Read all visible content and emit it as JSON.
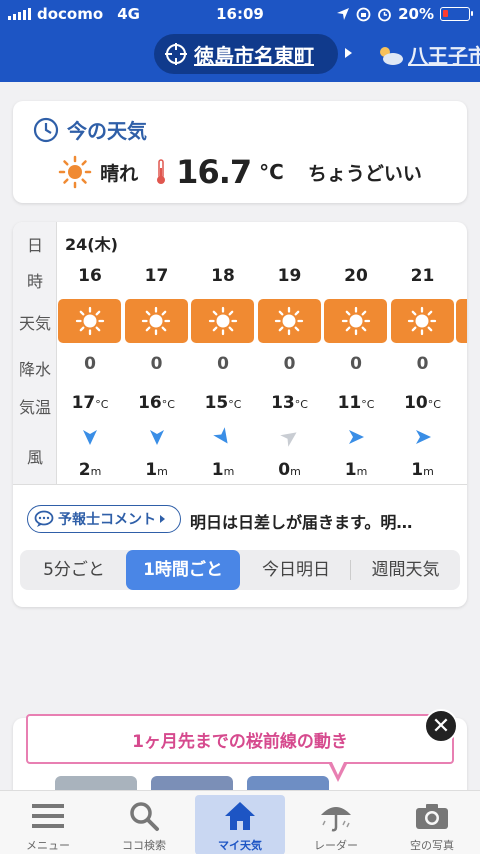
{
  "status": {
    "carrier": "docomo",
    "network": "4G",
    "time": "16:09",
    "battery": "20%"
  },
  "header": {
    "current_location": "徳島市名東町",
    "next_location": "八王子市"
  },
  "now": {
    "title": "今の天気",
    "condition": "晴れ",
    "temp": "16.7",
    "unit": "°C",
    "feel": "ちょうどいい"
  },
  "forecast": {
    "day": "24(木)",
    "row_labels": {
      "day": "日",
      "hour": "時",
      "weather": "天気",
      "rain": "降水",
      "temp": "気温",
      "wind": "風"
    },
    "temp_unit": "°C",
    "wind_unit": "m",
    "hours": [
      {
        "hour": "16",
        "rain": "0",
        "temp": "17",
        "wind": "2",
        "wind_dir": "down"
      },
      {
        "hour": "17",
        "rain": "0",
        "temp": "16",
        "wind": "1",
        "wind_dir": "down"
      },
      {
        "hour": "18",
        "rain": "0",
        "temp": "15",
        "wind": "1",
        "wind_dir": "down-right"
      },
      {
        "hour": "19",
        "rain": "0",
        "temp": "13",
        "wind": "0",
        "wind_dir": "up-right"
      },
      {
        "hour": "20",
        "rain": "0",
        "temp": "11",
        "wind": "1",
        "wind_dir": "right"
      },
      {
        "hour": "21",
        "rain": "0",
        "temp": "10",
        "wind": "1",
        "wind_dir": "right"
      }
    ],
    "comment_button": "予報士コメント",
    "comment_text": "明日は日差しが届きます。明…",
    "segments": [
      "5分ごと",
      "1時間ごと",
      "今日明日",
      "週間天気"
    ],
    "selected_segment": "1時間ごと"
  },
  "promo": {
    "banner": "1ヶ月先までの桜前線の動き"
  },
  "tabs": [
    {
      "label": "メニュー",
      "icon": "menu-icon"
    },
    {
      "label": "ココ検索",
      "icon": "search-icon"
    },
    {
      "label": "マイ天気",
      "icon": "home-icon"
    },
    {
      "label": "レーダー",
      "icon": "umbrella-icon"
    },
    {
      "label": "空の写真",
      "icon": "camera-icon"
    }
  ],
  "colors": {
    "header": "#1d55c4",
    "sun_box": "#f08a32",
    "wind_arrow": "#3a8ee6",
    "accent_pink": "#e87fb2",
    "active_tab": "#c9d7f2"
  }
}
